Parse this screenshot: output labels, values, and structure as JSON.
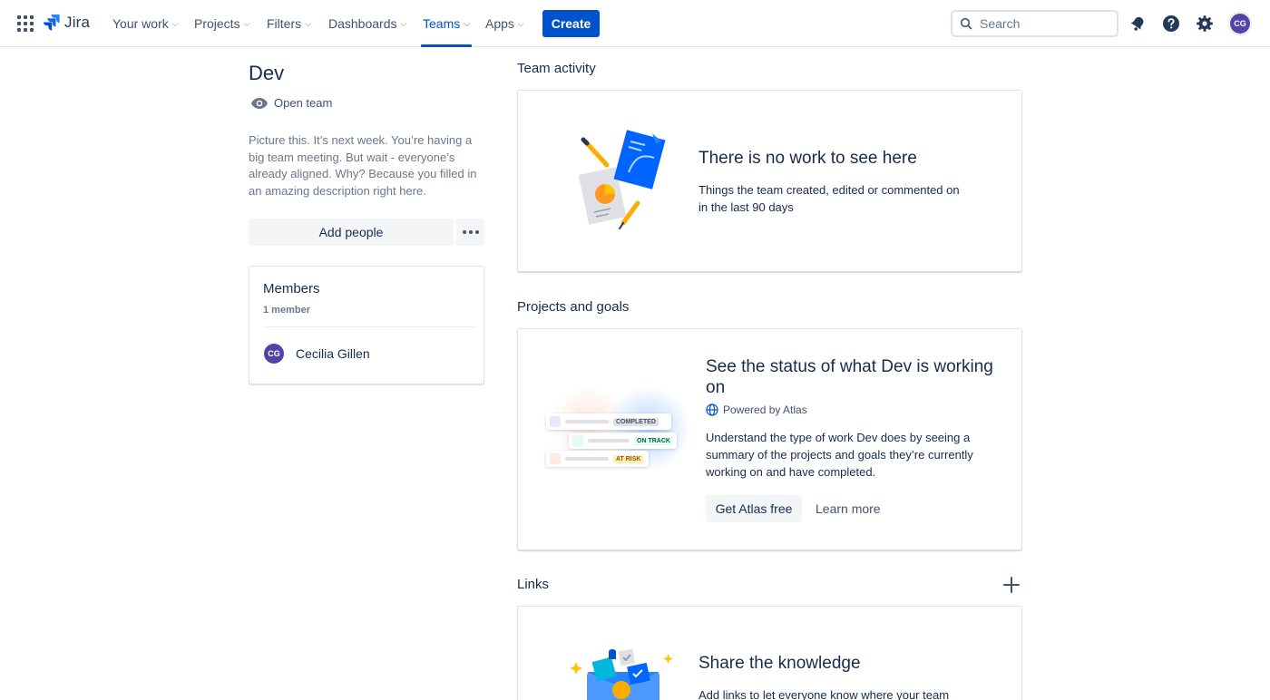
{
  "nav": {
    "logo_text": "Jira",
    "items": [
      {
        "label": "Your work"
      },
      {
        "label": "Projects"
      },
      {
        "label": "Filters"
      },
      {
        "label": "Dashboards"
      },
      {
        "label": "Teams",
        "active": true
      },
      {
        "label": "Apps"
      }
    ],
    "create_label": "Create",
    "search_placeholder": "Search",
    "user_initials": "CG",
    "icons": [
      "app-switcher-icon",
      "notifications-icon",
      "help-icon",
      "settings-icon"
    ]
  },
  "team": {
    "name": "Dev",
    "visibility": "Open team",
    "description": "Picture this. It’s next week. You’re having a big team meeting. But wait - everyone’s already aligned. Why? Because you filled in an amazing description right here.",
    "add_people_label": "Add people"
  },
  "members": {
    "title": "Members",
    "count": "1 member",
    "list": [
      {
        "initials": "CG",
        "name": "Cecilia Gillen"
      }
    ]
  },
  "activity": {
    "section_title": "Team activity",
    "heading": "There is no work to see here",
    "text": "Things the team created, edited or commented on in the last 90 days"
  },
  "projects": {
    "section_title": "Projects and goals",
    "heading": "See the status of what Dev is working on",
    "powered_by": "Powered by Atlas",
    "text": "Understand the type of work Dev does by seeing a summary of the projects and goals they’re currently working on and have completed.",
    "atlas_button": "Get Atlas free",
    "learn_more": "Learn more",
    "statuses": [
      "COMPLETED",
      "ON TRACK",
      "AT RISK"
    ]
  },
  "links": {
    "section_title": "Links",
    "heading": "Share the knowledge",
    "text": "Add links to let everyone know where your team"
  },
  "colors": {
    "brand": "#0052cc",
    "avatar": "#5243aa",
    "text": "#172b4d",
    "subtle": "#6b778c"
  }
}
